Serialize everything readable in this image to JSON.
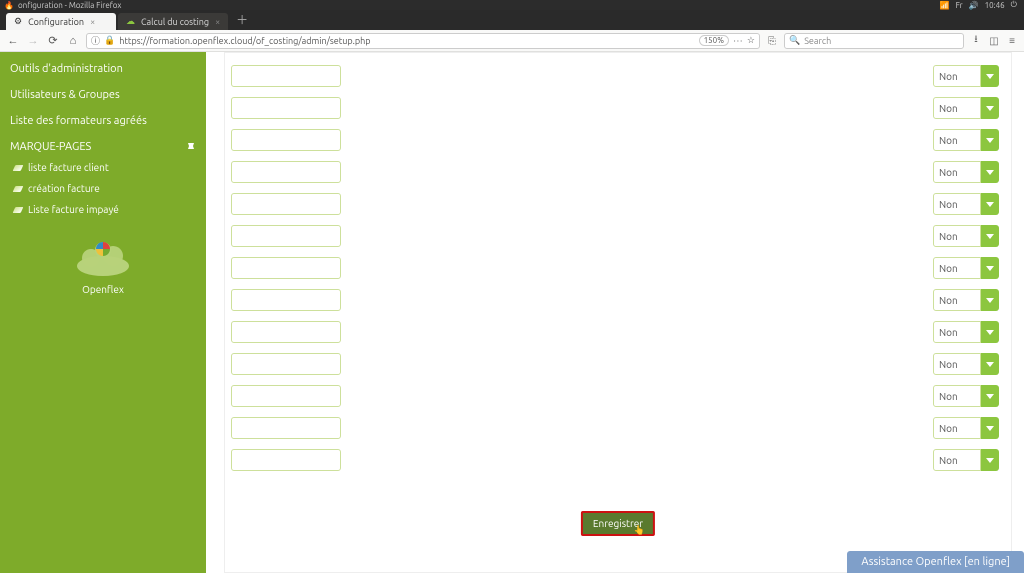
{
  "os": {
    "window_title": "onfiguration - Mozilla Firefox",
    "lang": "Fr",
    "time": "10:46"
  },
  "tabs": {
    "active": "Configuration",
    "second": "Calcul du costing"
  },
  "toolbar": {
    "url": "https://formation.openflex.cloud/of_costing/admin/setup.php",
    "zoom": "150%",
    "search_placeholder": "Search"
  },
  "sidebar": {
    "item_admin": "Outils d'administration",
    "item_users": "Utilisateurs & Groupes",
    "item_trainers": "Liste des formateurs agréés",
    "section_bookmarks": "MARQUE-PAGES",
    "bm1": "liste facture client",
    "bm2": "création facture",
    "bm3": "Liste facture impayé",
    "brand": "Openflex"
  },
  "form": {
    "option_no": "Non",
    "rows": [
      0,
      1,
      2,
      3,
      4,
      5,
      6,
      7,
      8,
      9,
      10,
      11,
      12
    ],
    "save_label": "Enregistrer"
  },
  "chat": {
    "label": "Assistance Openflex [en ligne]"
  }
}
